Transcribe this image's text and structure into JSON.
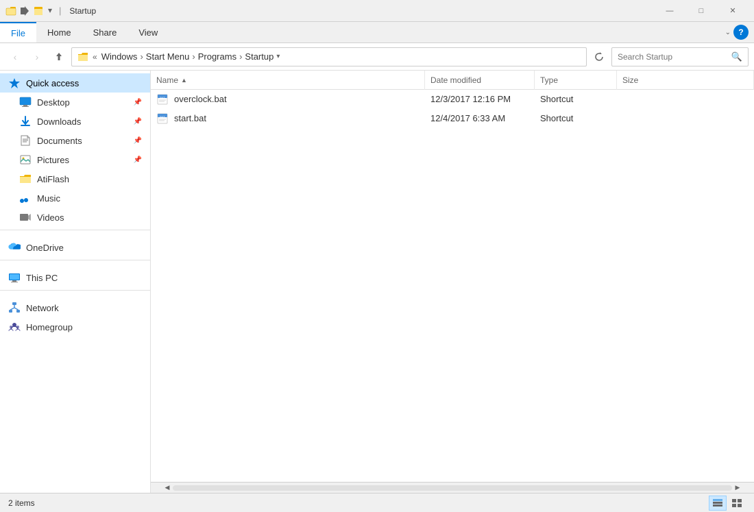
{
  "window": {
    "title": "Startup",
    "tabs": [
      "File",
      "Home",
      "Share",
      "View"
    ],
    "active_tab": "File"
  },
  "address": {
    "path_parts": [
      "Windows",
      "Start Menu",
      "Programs",
      "Startup"
    ],
    "search_placeholder": "Search Startup"
  },
  "sidebar": {
    "quick_access_label": "Quick access",
    "items": [
      {
        "id": "desktop",
        "label": "Desktop",
        "pinned": true,
        "icon": "desktop"
      },
      {
        "id": "downloads",
        "label": "Downloads",
        "pinned": true,
        "icon": "downloads"
      },
      {
        "id": "documents",
        "label": "Documents",
        "pinned": true,
        "icon": "documents"
      },
      {
        "id": "pictures",
        "label": "Pictures",
        "pinned": true,
        "icon": "pictures"
      },
      {
        "id": "atiflash",
        "label": "AtiFlash",
        "pinned": false,
        "icon": "folder"
      },
      {
        "id": "music",
        "label": "Music",
        "pinned": false,
        "icon": "music"
      },
      {
        "id": "videos",
        "label": "Videos",
        "pinned": false,
        "icon": "videos"
      }
    ],
    "drives": [
      {
        "id": "onedrive",
        "label": "OneDrive",
        "icon": "onedrive"
      },
      {
        "id": "thispc",
        "label": "This PC",
        "icon": "thispc"
      },
      {
        "id": "network",
        "label": "Network",
        "icon": "network"
      },
      {
        "id": "homegroup",
        "label": "Homegroup",
        "icon": "homegroup"
      }
    ]
  },
  "file_list": {
    "columns": [
      {
        "id": "name",
        "label": "Name",
        "sorted": true,
        "sort_dir": "asc"
      },
      {
        "id": "date",
        "label": "Date modified"
      },
      {
        "id": "type",
        "label": "Type"
      },
      {
        "id": "size",
        "label": "Size"
      }
    ],
    "files": [
      {
        "name": "overclock.bat",
        "date": "12/3/2017 12:16 PM",
        "type": "Shortcut",
        "size": ""
      },
      {
        "name": "start.bat",
        "date": "12/4/2017 6:33 AM",
        "type": "Shortcut",
        "size": ""
      }
    ]
  },
  "status": {
    "item_count": "2 items"
  },
  "icons": {
    "minimize": "—",
    "maximize": "□",
    "close": "✕",
    "back": "‹",
    "forward": "›",
    "up": "↑",
    "refresh": "↻",
    "search": "🔍",
    "sort_asc": "▲",
    "chevron_right": "›",
    "chevron_down": "⌄",
    "pin": "📌",
    "scroll_left": "◀",
    "scroll_right": "▶"
  }
}
